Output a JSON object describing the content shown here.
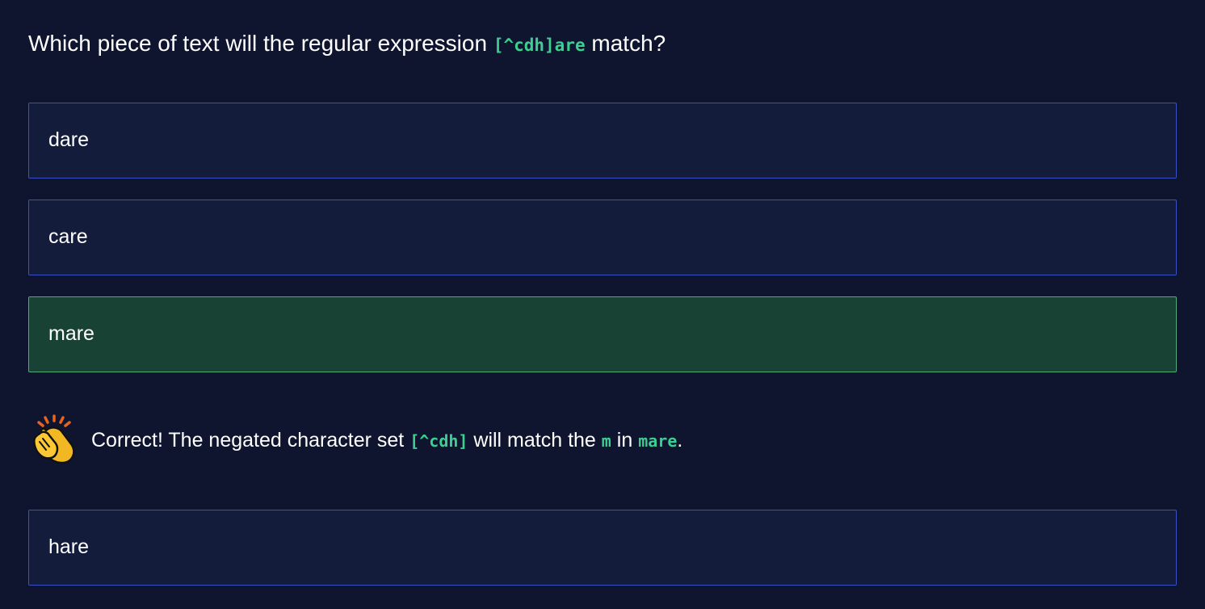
{
  "question": {
    "prefix": "Which piece of text will the regular expression ",
    "regex": "[^cdh]are",
    "suffix": " match?"
  },
  "options": [
    {
      "label": "dare",
      "state": "default"
    },
    {
      "label": "care",
      "state": "default"
    },
    {
      "label": "mare",
      "state": "correct"
    },
    {
      "label": "hare",
      "state": "default"
    }
  ],
  "feedback": {
    "icon": "clapping-hands-icon",
    "part1": "Correct! The negated character set ",
    "code1": "[^cdh]",
    "part2": " will match the ",
    "code2": "m",
    "part3": " in ",
    "code3": "mare",
    "part4": "."
  },
  "colors": {
    "background": "#10152f",
    "option_background": "#141c3b",
    "option_border": "#3a51c6",
    "correct_background": "#174234",
    "correct_border": "#4fa97a",
    "code_text": "#3ccf91"
  }
}
